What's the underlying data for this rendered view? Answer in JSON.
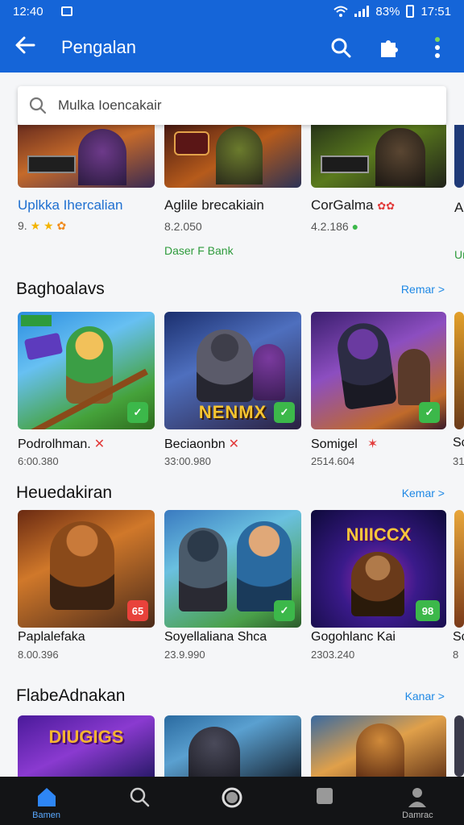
{
  "status": {
    "time": "12:40",
    "battery": "83%",
    "clock": "17:51"
  },
  "appbar": {
    "title": "Pengalan"
  },
  "search": {
    "placeholder": "Mulka Ioencakair"
  },
  "top_row": [
    {
      "name": "Uplkka Ihercalian",
      "meta": "9.",
      "badge_text": ""
    },
    {
      "name": "Aglile brecakiain",
      "meta": "8.2.050",
      "extra": "Daser F Bank"
    },
    {
      "name": "CorGalma",
      "meta": "4.2.186",
      "badge_text": ""
    },
    {
      "name": "A",
      "meta": "",
      "extra": "Ur"
    }
  ],
  "sections": [
    {
      "title": "Baghoalavs",
      "more": "Remar >",
      "items": [
        {
          "name": "Podrolhman.",
          "size": "6:00.380",
          "mark": "✕"
        },
        {
          "name": "Beciaonbn",
          "size": "33:00.980",
          "mark": "✕",
          "logo": "NENMX"
        },
        {
          "name": "Somigel",
          "size": "2514.604",
          "mark": "✶"
        },
        {
          "name": "Sc",
          "size": "31"
        }
      ]
    },
    {
      "title": "Heuedakiran",
      "more": "Kemar >",
      "items": [
        {
          "name": "Paplalefaka",
          "size": "8.00.396",
          "badge": "65"
        },
        {
          "name": "Soyellaliana Shca",
          "size": "23.9.990"
        },
        {
          "name": "Gogohlanc Kai",
          "size": "2303.240",
          "badge": "98",
          "logo": "NIIICCX"
        },
        {
          "name": "Sc",
          "size": "8"
        }
      ]
    },
    {
      "title": "FlabeAdnakan",
      "more": "Kanar >",
      "items": [
        {
          "logo": "DIUGIGS"
        },
        {},
        {},
        {}
      ]
    }
  ],
  "bottom_nav": [
    {
      "label": "Bamen",
      "icon": "home-icon",
      "active": true
    },
    {
      "label": "",
      "icon": "search-icon"
    },
    {
      "label": "",
      "icon": "circle-icon"
    },
    {
      "label": "",
      "icon": "square-icon"
    },
    {
      "label": "Damrac",
      "icon": "person-icon"
    }
  ],
  "colors": {
    "primary": "#1565d8",
    "accent": "#1e88e5",
    "badge_green": "#3cb84a",
    "badge_red": "#e8423b",
    "nav_bg": "#131416"
  }
}
